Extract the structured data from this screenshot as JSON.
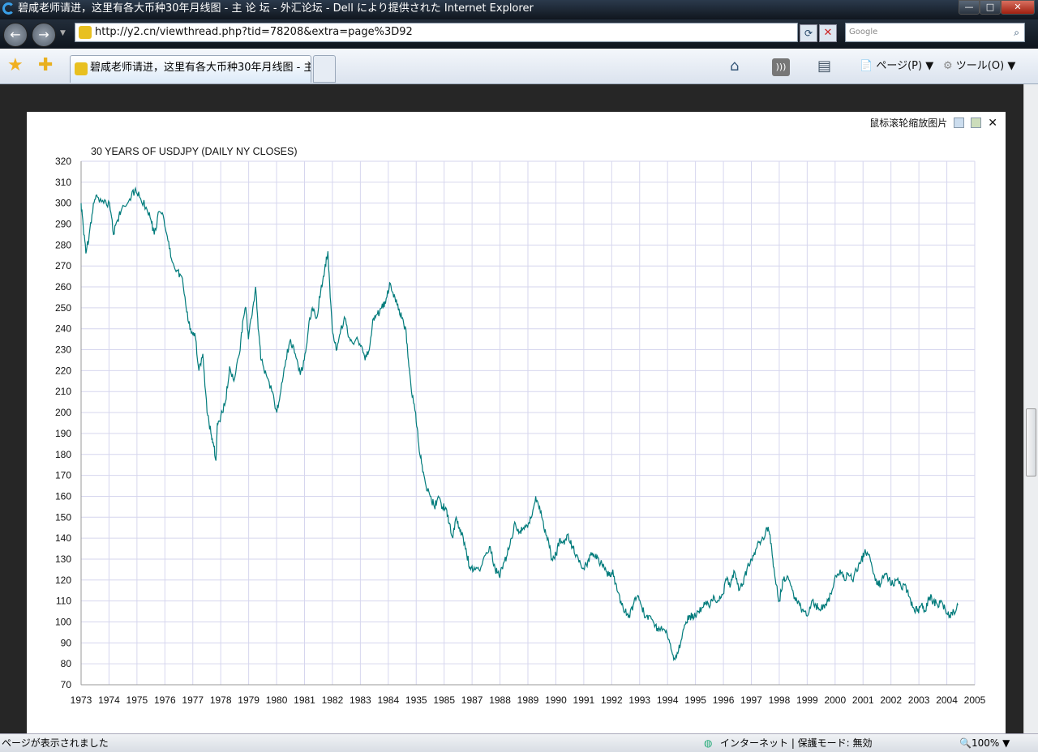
{
  "window": {
    "title": "碧咸老师请进，这里有各大币种30年月线图 - 主 论 坛 - 外汇论坛 - Dell により提供された Internet Explorer",
    "min": "—",
    "max": "□",
    "close": "✕"
  },
  "address": {
    "url": "http://y2.cn/viewthread.php?tid=78208&extra=page%3D92",
    "search_placeholder": "Google"
  },
  "tab": {
    "label": "碧咸老师请进，这里有各大币种30年月线图 - 主..."
  },
  "toolbar": {
    "page": "ページ(P)",
    "tools": "ツール(O)"
  },
  "viewer": {
    "hint": "鼠标滚轮缩放图片",
    "close": "✕"
  },
  "status": {
    "left": "ページが表示されました",
    "zone": "インターネット | 保護モード: 無効",
    "zoom": "100%"
  },
  "colors": {
    "line": "#007b7b",
    "grid": "#d6d6ee"
  },
  "chart_data": {
    "type": "line",
    "title": "30 YEARS OF USDJPY (DAILY NY CLOSES)",
    "xlabel": "",
    "ylabel": "",
    "xlim": [
      1973,
      2005
    ],
    "ylim": [
      70,
      320
    ],
    "x_tick_labels": [
      "1973",
      "1974",
      "1975",
      "1976",
      "1977",
      "1978",
      "1979",
      "1980",
      "1981",
      "1982",
      "1983",
      "1984",
      "1935",
      "1985",
      "1987",
      "1988",
      "1989",
      "1990",
      "1991",
      "1992",
      "1993",
      "1994",
      "1995",
      "1996",
      "1997",
      "1998",
      "1999",
      "2000",
      "2001",
      "2002",
      "2003",
      "2004",
      "2005"
    ],
    "y_ticks": [
      70,
      80,
      90,
      100,
      110,
      120,
      130,
      140,
      150,
      160,
      170,
      180,
      190,
      200,
      210,
      220,
      230,
      240,
      250,
      260,
      270,
      280,
      290,
      300,
      310,
      320
    ],
    "grid": true,
    "series": [
      {
        "name": "USDJPY",
        "points": [
          [
            1973.0,
            300
          ],
          [
            1973.06,
            292
          ],
          [
            1973.17,
            276
          ],
          [
            1973.29,
            285
          ],
          [
            1973.44,
            300
          ],
          [
            1973.58,
            303
          ],
          [
            1973.81,
            300
          ],
          [
            1974.02,
            300
          ],
          [
            1974.16,
            285
          ],
          [
            1974.31,
            292
          ],
          [
            1974.45,
            297
          ],
          [
            1974.74,
            302
          ],
          [
            1974.92,
            306
          ],
          [
            1975.09,
            303
          ],
          [
            1975.33,
            298
          ],
          [
            1975.5,
            292
          ],
          [
            1975.62,
            285
          ],
          [
            1975.79,
            296
          ],
          [
            1975.97,
            292
          ],
          [
            1976.11,
            282
          ],
          [
            1976.26,
            272
          ],
          [
            1976.43,
            268
          ],
          [
            1976.6,
            265
          ],
          [
            1976.78,
            248
          ],
          [
            1976.92,
            240
          ],
          [
            1977.07,
            238
          ],
          [
            1977.22,
            220
          ],
          [
            1977.36,
            228
          ],
          [
            1977.51,
            200
          ],
          [
            1977.65,
            190
          ],
          [
            1977.74,
            185
          ],
          [
            1977.83,
            177
          ],
          [
            1977.88,
            195
          ],
          [
            1978.0,
            198
          ],
          [
            1978.17,
            205
          ],
          [
            1978.32,
            222
          ],
          [
            1978.47,
            215
          ],
          [
            1978.67,
            228
          ],
          [
            1978.81,
            245
          ],
          [
            1978.9,
            250
          ],
          [
            1978.99,
            235
          ],
          [
            1979.1,
            245
          ],
          [
            1979.25,
            260
          ],
          [
            1979.34,
            240
          ],
          [
            1979.45,
            225
          ],
          [
            1979.63,
            218
          ],
          [
            1979.83,
            210
          ],
          [
            1980.01,
            200
          ],
          [
            1980.15,
            210
          ],
          [
            1980.33,
            225
          ],
          [
            1980.5,
            235
          ],
          [
            1980.67,
            228
          ],
          [
            1980.85,
            218
          ],
          [
            1980.99,
            225
          ],
          [
            1981.14,
            240
          ],
          [
            1981.28,
            250
          ],
          [
            1981.43,
            245
          ],
          [
            1981.58,
            258
          ],
          [
            1981.72,
            268
          ],
          [
            1981.84,
            277
          ],
          [
            1981.92,
            255
          ],
          [
            1982.01,
            238
          ],
          [
            1982.16,
            230
          ],
          [
            1982.3,
            240
          ],
          [
            1982.45,
            245
          ],
          [
            1982.59,
            236
          ],
          [
            1982.74,
            233
          ],
          [
            1982.88,
            236
          ],
          [
            1983.03,
            232
          ],
          [
            1983.17,
            225
          ],
          [
            1983.32,
            230
          ],
          [
            1983.47,
            245
          ],
          [
            1983.61,
            247
          ],
          [
            1983.76,
            250
          ],
          [
            1983.9,
            252
          ],
          [
            1984.05,
            262
          ],
          [
            1984.19,
            255
          ],
          [
            1984.34,
            252
          ],
          [
            1984.48,
            245
          ],
          [
            1984.63,
            240
          ],
          [
            1984.72,
            225
          ],
          [
            1984.83,
            210
          ],
          [
            1984.98,
            200
          ],
          [
            1985.09,
            185
          ],
          [
            1985.21,
            175
          ],
          [
            1985.35,
            165
          ],
          [
            1985.5,
            160
          ],
          [
            1985.65,
            155
          ],
          [
            1985.79,
            160
          ],
          [
            1985.94,
            155
          ],
          [
            1986.08,
            154
          ],
          [
            1986.17,
            147
          ],
          [
            1986.31,
            140
          ],
          [
            1986.43,
            150
          ],
          [
            1986.55,
            145
          ],
          [
            1986.66,
            142
          ],
          [
            1986.81,
            132
          ],
          [
            1986.95,
            125
          ],
          [
            1987.1,
            125
          ],
          [
            1987.24,
            125
          ],
          [
            1987.48,
            132
          ],
          [
            1987.65,
            136
          ],
          [
            1987.83,
            125
          ],
          [
            1987.97,
            122
          ],
          [
            1988.12,
            128
          ],
          [
            1988.26,
            132
          ],
          [
            1988.41,
            140
          ],
          [
            1988.55,
            147
          ],
          [
            1988.7,
            143
          ],
          [
            1988.84,
            145
          ],
          [
            1988.99,
            145
          ],
          [
            1989.13,
            150
          ],
          [
            1989.28,
            160
          ],
          [
            1989.42,
            155
          ],
          [
            1989.57,
            145
          ],
          [
            1989.72,
            140
          ],
          [
            1989.86,
            130
          ],
          [
            1990.01,
            132
          ],
          [
            1990.15,
            140
          ],
          [
            1990.3,
            137
          ],
          [
            1990.44,
            142
          ],
          [
            1990.59,
            136
          ],
          [
            1990.73,
            132
          ],
          [
            1990.88,
            128
          ],
          [
            1991.02,
            125
          ],
          [
            1991.17,
            130
          ],
          [
            1991.31,
            133
          ],
          [
            1991.46,
            130
          ],
          [
            1991.6,
            128
          ],
          [
            1991.75,
            125
          ],
          [
            1991.9,
            122
          ],
          [
            1992.04,
            125
          ],
          [
            1992.19,
            115
          ],
          [
            1992.33,
            110
          ],
          [
            1992.48,
            105
          ],
          [
            1992.62,
            103
          ],
          [
            1992.77,
            108
          ],
          [
            1992.91,
            112
          ],
          [
            1993.06,
            108
          ],
          [
            1993.2,
            102
          ],
          [
            1993.35,
            103
          ],
          [
            1993.49,
            100
          ],
          [
            1993.64,
            97
          ],
          [
            1993.78,
            98
          ],
          [
            1993.93,
            95
          ],
          [
            1994.08,
            90
          ],
          [
            1994.22,
            82
          ],
          [
            1994.37,
            85
          ],
          [
            1994.51,
            92
          ],
          [
            1994.66,
            100
          ],
          [
            1994.8,
            103
          ],
          [
            1994.95,
            102
          ],
          [
            1995.09,
            105
          ],
          [
            1995.24,
            107
          ],
          [
            1995.38,
            110
          ],
          [
            1995.53,
            108
          ],
          [
            1995.67,
            112
          ],
          [
            1995.82,
            110
          ],
          [
            1995.97,
            113
          ],
          [
            1996.11,
            120
          ],
          [
            1996.26,
            118
          ],
          [
            1996.4,
            124
          ],
          [
            1996.55,
            115
          ],
          [
            1996.69,
            118
          ],
          [
            1996.84,
            125
          ],
          [
            1996.98,
            130
          ],
          [
            1997.13,
            132
          ],
          [
            1997.27,
            138
          ],
          [
            1997.42,
            140
          ],
          [
            1997.56,
            145
          ],
          [
            1997.65,
            142
          ],
          [
            1997.77,
            130
          ],
          [
            1997.88,
            118
          ],
          [
            1998.0,
            110
          ],
          [
            1998.15,
            120
          ],
          [
            1998.29,
            122
          ],
          [
            1998.44,
            117
          ],
          [
            1998.58,
            110
          ],
          [
            1998.73,
            108
          ],
          [
            1998.87,
            105
          ],
          [
            1999.02,
            103
          ],
          [
            1999.16,
            110
          ],
          [
            1999.31,
            108
          ],
          [
            1999.45,
            106
          ],
          [
            1999.6,
            108
          ],
          [
            1999.74,
            110
          ],
          [
            1999.89,
            115
          ],
          [
            2000.03,
            122
          ],
          [
            2000.18,
            125
          ],
          [
            2000.33,
            120
          ],
          [
            2000.47,
            123
          ],
          [
            2000.62,
            120
          ],
          [
            2000.76,
            125
          ],
          [
            2000.91,
            128
          ],
          [
            2001.05,
            133
          ],
          [
            2001.2,
            132
          ],
          [
            2001.34,
            125
          ],
          [
            2001.49,
            118
          ],
          [
            2001.63,
            118
          ],
          [
            2001.78,
            123
          ],
          [
            2001.92,
            120
          ],
          [
            2002.07,
            118
          ],
          [
            2002.22,
            120
          ],
          [
            2002.36,
            117
          ],
          [
            2002.51,
            118
          ],
          [
            2002.65,
            112
          ],
          [
            2002.8,
            107
          ],
          [
            2002.94,
            105
          ],
          [
            2003.09,
            108
          ],
          [
            2003.23,
            105
          ],
          [
            2003.38,
            112
          ],
          [
            2003.52,
            110
          ],
          [
            2003.67,
            108
          ],
          [
            2003.81,
            110
          ],
          [
            2003.96,
            105
          ],
          [
            2004.1,
            103
          ],
          [
            2004.25,
            105
          ],
          [
            2004.4,
            108
          ]
        ]
      }
    ]
  }
}
